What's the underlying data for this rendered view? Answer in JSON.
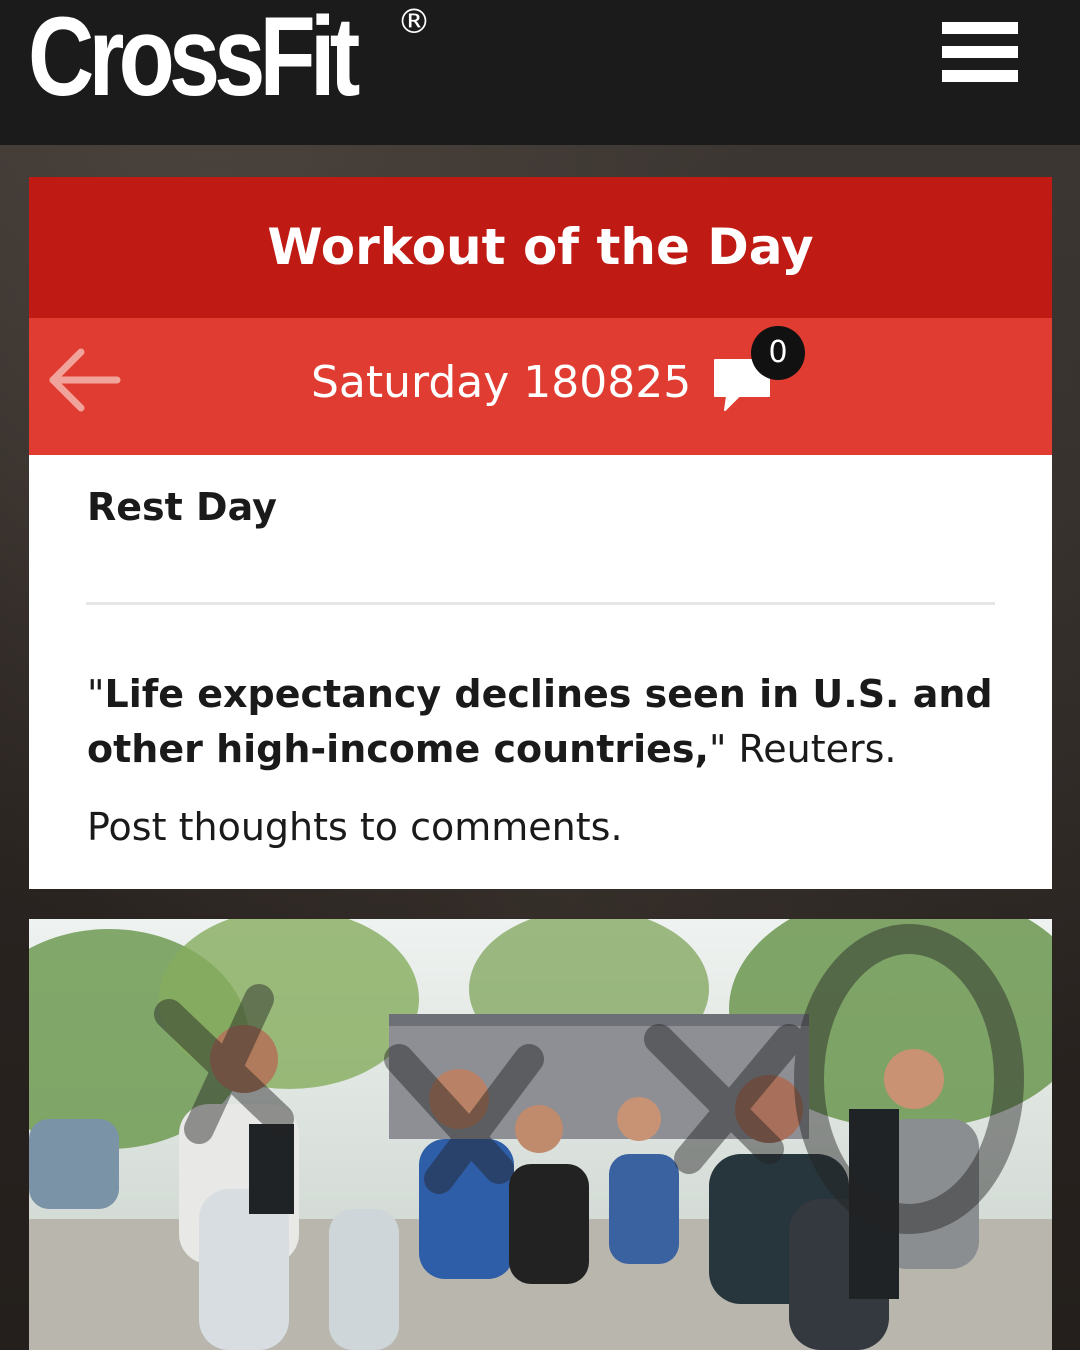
{
  "header": {
    "logo": "CrossFit",
    "registered": "®",
    "menu_icon": "hamburger-menu-icon"
  },
  "card": {
    "title": "Workout of the Day",
    "date": "Saturday 180825",
    "comment_count": "0",
    "back_icon": "arrow-left-icon",
    "comment_icon": "speech-bubble-icon"
  },
  "post": {
    "workout": "Rest Day",
    "quote_open": "\"",
    "headline_bold": "Life expectancy declines seen in U.S. and other high-income countries,",
    "headline_rest": "\" Reuters.",
    "cta": "Post thoughts to comments."
  },
  "colors": {
    "header_red": "#bf1a13",
    "date_bar_red": "#e03c31",
    "topbar": "#1b1b1b"
  }
}
